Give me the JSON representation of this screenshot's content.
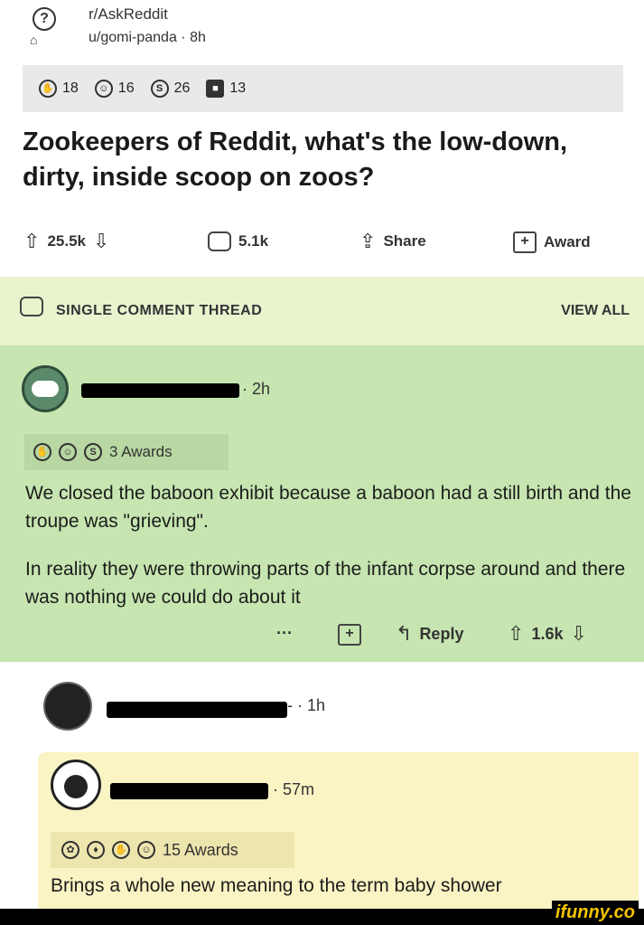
{
  "post": {
    "subreddit": "r/AskReddit",
    "author_line": "u/gomi-panda · 8h",
    "awards": [
      {
        "icon": "crossed-hands-award-icon",
        "count": "18"
      },
      {
        "icon": "wholesome-face-award-icon",
        "count": "16"
      },
      {
        "icon": "silver-coin-award-icon",
        "count": "26"
      },
      {
        "icon": "dark-award-icon",
        "count": "13"
      }
    ],
    "title": "Zookeepers of Reddit, what's the low-down, dirty, inside scoop on zoos?",
    "votes": "25.5k",
    "comments": "5.1k",
    "share_label": "Share",
    "award_label": "Award"
  },
  "thread": {
    "label": "SINGLE COMMENT THREAD",
    "view_all": "VIEW ALL"
  },
  "comment1": {
    "time": "· 2h",
    "awards_label": "3 Awards",
    "paragraphs": [
      "We closed the baboon exhibit because a baboon had a still birth and the troupe was \"grieving\".",
      "In reality they were throwing parts of the infant corpse around and there was nothing we could do about it"
    ],
    "more": "···",
    "reply_label": "Reply",
    "votes": "1.6k"
  },
  "comment2": {
    "meta": "- · 1h"
  },
  "comment3": {
    "time": "· 57m",
    "awards_label": "15 Awards",
    "text": "Brings a whole new meaning to the term baby shower"
  },
  "watermark": "ifunny.co"
}
